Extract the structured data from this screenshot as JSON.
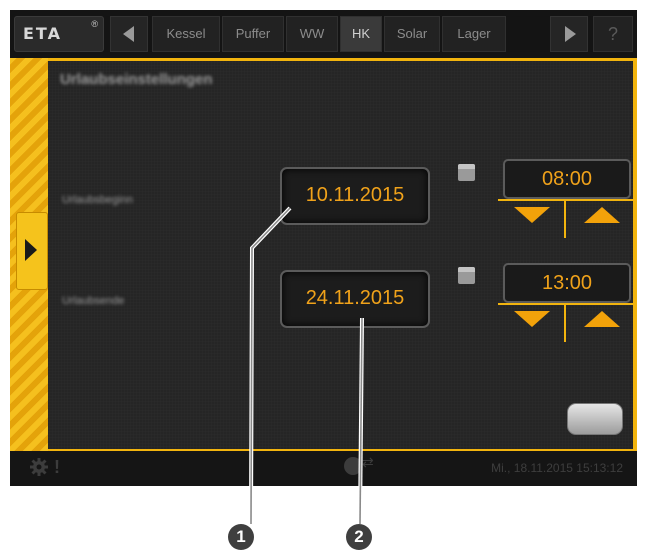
{
  "topbar": {
    "logo_text": "ETA",
    "logo_mark": "®",
    "tabs": [
      "Kessel",
      "Puffer",
      "WW",
      "HK",
      "Solar",
      "Lager"
    ],
    "active_tab": "HK",
    "help_label": "?"
  },
  "panel": {
    "title": "Urlaubseinstellungen",
    "start_label": "Urlaubsbeginn",
    "end_label": "Urlaubsende",
    "start_date": "10.11.2015",
    "start_time": "08:00",
    "end_date": "24.11.2015",
    "end_time": "13:00"
  },
  "statusbar": {
    "warning": "!",
    "datetime": "Mi., 18.11.2015 15:13:12"
  },
  "callouts": [
    "1",
    "2"
  ],
  "colors": {
    "accent": "#f2b40e",
    "value_text": "#f0a21a",
    "background": "#252525"
  },
  "icons": [
    "eta-logo-icon",
    "arrow-left-icon",
    "arrow-right-icon",
    "help-icon",
    "menu-arrow-icon",
    "calendar-icon",
    "down-arrow-icon",
    "up-arrow-icon",
    "gear-icon",
    "warning-icon",
    "globe-icon"
  ]
}
